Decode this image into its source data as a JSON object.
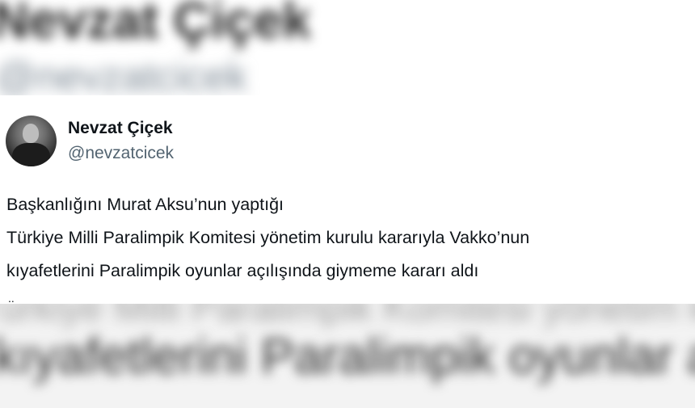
{
  "author": {
    "display_name": "Nevzat Çiçek",
    "handle": "@nevzatcicek",
    "avatar_icon": "person-avatar-icon"
  },
  "tweet": {
    "lines": [
      "Başkanlığını Murat Aksu’nun yaptığı",
      "Türkiye Milli Paralimpik Komitesi yönetim kurulu kararıyla Vakko’nun",
      "kıyafetlerini Paralimpik oyunlar açılışında giymeme kararı aldı"
    ],
    "continuation": ".."
  },
  "background_echo": {
    "top_name": "Nevzat Çiçek",
    "top_handle": "@nevzatcicek",
    "bottom_line_1": "Türkiye Milli Paralimpik Komitesi yönetim kurulu kararıyla Vakko’nun",
    "bottom_line_2": "kıyafetlerini Paralimpik oyunlar açılışında giymeme kararı aldı"
  },
  "colors": {
    "text_primary": "#0f1419",
    "text_secondary": "#536471",
    "background": "#ffffff"
  }
}
